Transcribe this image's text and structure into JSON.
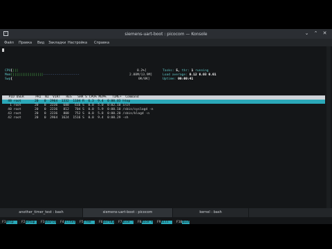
{
  "window": {
    "title": "siemens-uart-boot : picocom — Konsole"
  },
  "menu": [
    "Файл",
    "Правка",
    "Вид",
    "Закладки",
    "Настройка",
    "Справка"
  ],
  "htop": {
    "cpu_label": "CPU",
    "cpu_bar": "[",
    "cpu_bar_fill": "|||",
    "cpu_value": "8.2%]",
    "mem_label": "Mem",
    "mem_bar": "[||||||||||||||||",
    "mem_bar_rest": "-------------------",
    "mem_value": "2.88M/13.9M]",
    "swp_label": "Swp",
    "swp_bar": "[",
    "swp_value": "0K/0K]",
    "tasks_label": "Tasks:",
    "tasks_value": "5,",
    "thr_label": "thr:",
    "thr_value": "1",
    "tasks_suffix": "running",
    "load_label": "Load average:",
    "load_value": "0.12 0.03 0.01",
    "uptime_label": "Uptime:",
    "uptime_value": "00:00:41",
    "columns_line": "  PID USER      PRI  NI  VIRT   RES   SHR S CPU% MEM%   TIME+  Command",
    "processes": [
      "   48 root       20   0  2964  1332  1104 R  6.3  9.4  0:00.03 htop",
      "    1 root       20   0  2236   680   616 S  0.0  5.0  0:02.10 init",
      "   40 root       20   0  2236   812   704 S  0.0  5.9  0:00.10 /sbin/syslogd -n",
      "   43 root       20   0  2236   808   752 S  0.0  5.8  0:00.20 /sbin/klogd -n",
      "   42 root       20   0  2964  1624  1516 S  0.0  9.4  0:00.29 -sh"
    ],
    "fkeys": [
      {
        "key": "F1",
        "label": "Help  "
      },
      {
        "key": "F2",
        "label": "Setup "
      },
      {
        "key": "F3",
        "label": "Search"
      },
      {
        "key": "F4",
        "label": "Filter"
      },
      {
        "key": "F5",
        "label": "Tree  "
      },
      {
        "key": "F6",
        "label": "SortBy"
      },
      {
        "key": "F7",
        "label": "Nice -"
      },
      {
        "key": "F8",
        "label": "Nice +"
      },
      {
        "key": "F9",
        "label": "Kill  "
      },
      {
        "key": "F10",
        "label": "Quit"
      }
    ]
  },
  "tabs": [
    {
      "label": "another_timer_test : bash",
      "active": false
    },
    {
      "label": "siemens-uart-boot : picocom",
      "active": true
    },
    {
      "label": "kernel : bash",
      "active": false
    }
  ]
}
